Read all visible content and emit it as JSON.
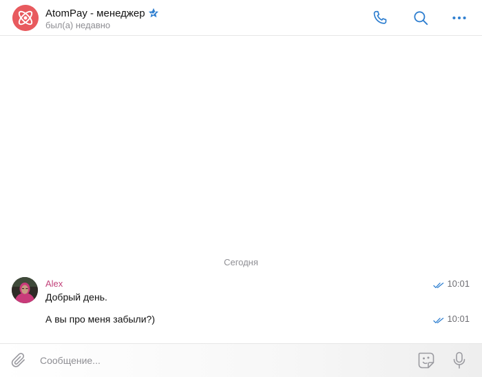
{
  "header": {
    "title": "AtomPay - менеджер",
    "status": "был(а) недавно",
    "verified_icon": "star-verified-icon",
    "actions": [
      "phone-icon",
      "search-icon",
      "more-icon"
    ]
  },
  "colors": {
    "accent": "#2f7fd0",
    "brand": "#e85a5e",
    "author": "#c2427a",
    "muted": "#8e8e93"
  },
  "messages": {
    "date_separator": "Сегодня",
    "items": [
      {
        "author": "Alex",
        "text": "Добрый день.",
        "time": "10:01",
        "status": "read"
      },
      {
        "text": "А вы про меня забыли?)",
        "time": "10:01",
        "status": "read"
      }
    ]
  },
  "composer": {
    "placeholder": "Сообщение...",
    "value": "",
    "icons": [
      "attach-icon",
      "sticker-icon",
      "mic-icon"
    ]
  }
}
